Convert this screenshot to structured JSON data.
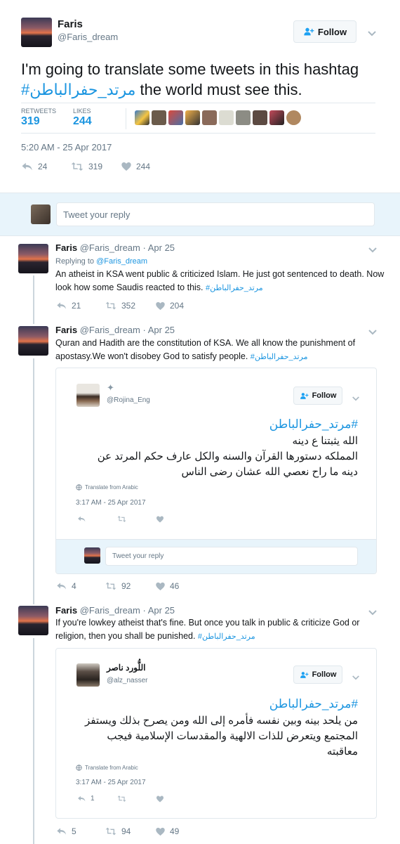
{
  "main_tweet": {
    "name": "Faris",
    "handle": "@Faris_dream",
    "follow_label": "Follow",
    "text_pre": "I'm going to translate some tweets in this hashtag ",
    "hashtag": "#مرتد_حفرالباطن",
    "text_post": " the world must see this.",
    "retweets_label": "RETWEETS",
    "retweets_count": "319",
    "likes_label": "LIKES",
    "likes_count": "244",
    "timestamp": "5:20 AM - 25 Apr 2017",
    "actions": {
      "replies": "24",
      "retweets": "319",
      "likes": "244"
    }
  },
  "reply_box": {
    "placeholder": "Tweet your reply"
  },
  "thread": [
    {
      "name": "Faris",
      "handle": "@Faris_dream",
      "date": "· Apr 25",
      "replying_prefix": "Replying to ",
      "replying_handle": "@Faris_dream",
      "text": "An atheist in KSA went public & criticized Islam. He just got sentenced to death. Now look how some Saudis reacted to this. ",
      "hashtag": "#مرتد_حفرالباطن",
      "actions": {
        "replies": "21",
        "retweets": "352",
        "likes": "204"
      }
    },
    {
      "name": "Faris",
      "handle": "@Faris_dream",
      "date": "· Apr 25",
      "text": "Quran and Hadith are the constitution of KSA. We all know the punishment of apostasy.We won't disobey God to satisfy people. ",
      "hashtag": "#مرتد_حفرالباطن",
      "quote": {
        "handle": "@Rojina_Eng",
        "follow_label": "Follow",
        "hashtag": "#مرتد_حفرالباطن",
        "lines": [
          "الله يثبتنا ع دينه",
          "المملكه دستورها القرآن والسنه والكل عارف حكم المرتد عن",
          "دينه ما راح نعصي الله عشان رضى الناس"
        ],
        "translate_label": "Translate from Arabic",
        "timestamp": "3:17 AM - 25 Apr 2017",
        "reply_placeholder": "Tweet your reply"
      },
      "actions": {
        "replies": "4",
        "retweets": "92",
        "likes": "46"
      }
    },
    {
      "name": "Faris",
      "handle": "@Faris_dream",
      "date": "· Apr 25",
      "text": "If you're lowkey atheist that's fine. But once you talk in public & criticize God or religion, then you shall be punished. ",
      "hashtag": "#مرتد_حفرالباطن",
      "quote": {
        "name": "اللُّورد ناصر",
        "handle": "@alz_nasser",
        "follow_label": "Follow",
        "hashtag": "#مرتد_حفرالباطن",
        "lines": [
          "من يلحد بينه وبين نفسه فأمره إلى الله ومن يصرح بذلك ويستفز",
          "المجتمع ويتعرض للذات الالهية والمقدسات الإسلامية فيجب",
          "معاقبته"
        ],
        "translate_label": "Translate from Arabic",
        "timestamp": "3:17 AM - 25 Apr 2017",
        "actions": {
          "replies": "1"
        }
      },
      "actions": {
        "replies": "5",
        "retweets": "94",
        "likes": "49"
      }
    }
  ],
  "colors": {
    "accent": "#1da1f2",
    "link": "#1b95e0",
    "muted": "#657786",
    "border": "#e1e8ed",
    "reply_bg": "#e8f4fb"
  }
}
